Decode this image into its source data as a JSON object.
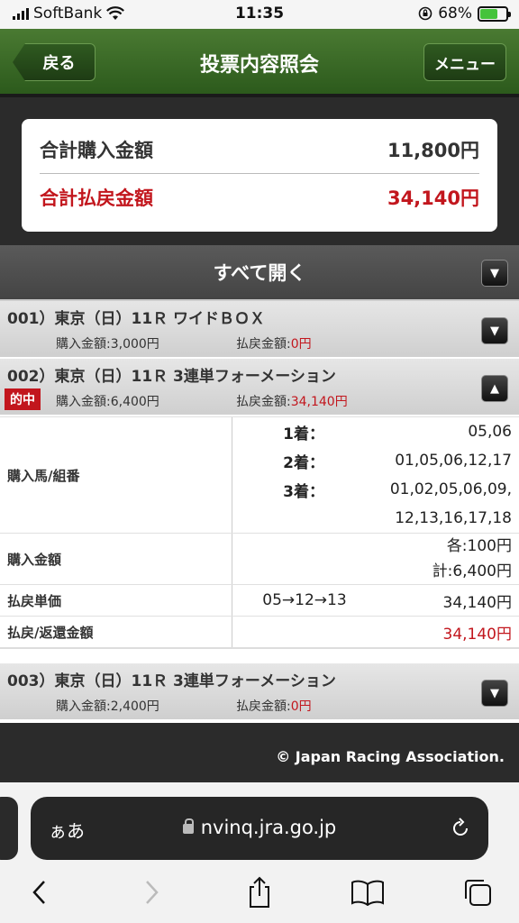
{
  "status_bar": {
    "carrier": "SoftBank",
    "time": "11:35",
    "battery": "68%",
    "battery_level": 0.68
  },
  "header": {
    "title": "投票内容照会",
    "back_label": "戻る",
    "menu_label": "メニュー"
  },
  "summary": {
    "total_purchase_label": "合計購入金額",
    "total_purchase_value": "11,800円",
    "total_payout_label": "合計払戻金額",
    "total_payout_value": "34,140円"
  },
  "open_all_label": "すべて開く",
  "entries": [
    {
      "title": "001）東京（日）11Ｒ ワイドＢＯＸ",
      "purchase_label": "購入金額:",
      "purchase_value": "3,000円",
      "payout_label": "払戻金額:",
      "payout_value": "0円"
    },
    {
      "title": "002）東京（日）11Ｒ 3連単フォーメーション",
      "hit_label": "的中",
      "purchase_label": "購入金額:",
      "purchase_value": "6,400円",
      "payout_label": "払戻金額:",
      "payout_value": "34,140円",
      "detail": {
        "horses_label": "購入馬/組番",
        "first_label": "1着：",
        "first_value": "05,06",
        "second_label": "2着：",
        "second_value": "01,05,06,12,17",
        "third_label": "3着：",
        "third_value_1": "01,02,05,06,09,",
        "third_value_2": "12,13,16,17,18",
        "amount_label": "購入金額",
        "each_value": "各:100円",
        "total_value": "計:6,400円",
        "unit_label": "払戻単価",
        "unit_combo": "05→12→13",
        "unit_value": "34,140円",
        "refund_label": "払戻/返還金額",
        "refund_value": "34,140円"
      }
    },
    {
      "title": "003）東京（日）11Ｒ 3連単フォーメーション",
      "purchase_label": "購入金額:",
      "purchase_value": "2,400円",
      "payout_label": "払戻金額:",
      "payout_value": "0円"
    }
  ],
  "footer": {
    "copyright": "© Japan Racing Association."
  },
  "browser": {
    "aa_label": "ぁあ",
    "url": "nvinq.jra.go.jp"
  },
  "icons": [
    "wifi-icon",
    "lock-rotation-icon",
    "battery-icon",
    "chevron-down-icon",
    "chevron-up-icon",
    "lock-icon",
    "reload-icon",
    "back-icon",
    "forward-icon",
    "share-icon",
    "bookmarks-icon",
    "tabs-icon"
  ]
}
